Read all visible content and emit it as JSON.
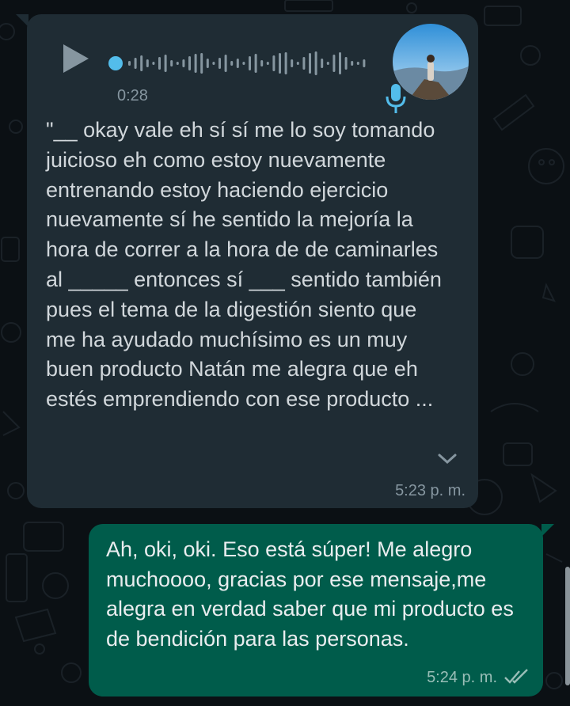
{
  "voice_message": {
    "duration": "0:28",
    "transcript": "\"__ okay vale eh sí sí me lo soy tomando juicioso eh como estoy nuevamente entrenando estoy haciendo ejercicio nuevamente sí he sentido la mejoría la hora de correr a la hora de de caminarles al _____ entonces sí ___ sentido también pues el tema de la digestión siento que me ha ayudado muchísimo es un muy buen producto Natán me alegra que eh estés emprendiendo con ese producto ...",
    "time": "5:23 p. m.",
    "play_icon": "play-icon",
    "mic_icon": "microphone-icon",
    "expand_icon": "chevron-down-icon"
  },
  "reply_message": {
    "text": "Ah, oki, oki. Eso está súper! Me alegro muchoooo, gracias por ese mensaje,me alegra en verdad saber que mi producto es de bendición para las personas.",
    "time": "5:24 p. m.",
    "status_icon": "double-check-icon"
  },
  "colors": {
    "background": "#0b1014",
    "incoming_bubble": "#1f2c34",
    "outgoing_bubble": "#005c4b",
    "waveform": "#8696a0",
    "play_dot": "#53bdeb"
  }
}
